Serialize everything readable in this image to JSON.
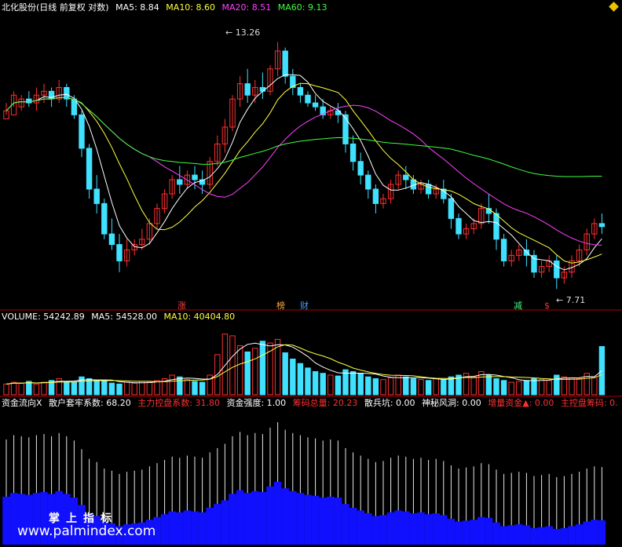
{
  "header": {
    "title": "北化股份(日线 前复权 对数)",
    "ma5": "MA5: 8.84",
    "ma10": "MA10: 8.60",
    "ma20": "MA20: 8.51",
    "ma60": "MA60: 9.13"
  },
  "volume_header": {
    "volume": "VOLUME: 54242.89",
    "ma5": "MA5: 54528.00",
    "ma10": "MA10: 40404.80"
  },
  "indicator_header": {
    "name": "资金流向X",
    "items": [
      {
        "label": "散户套牢系数: 68.20",
        "color": "#ffffff"
      },
      {
        "label": "主力控盘系数: 31.80",
        "color": "#ff3030"
      },
      {
        "label": "资金强度: 1.00",
        "color": "#ffffff"
      },
      {
        "label": "筹码总量: 20.23",
        "color": "#ff3030"
      },
      {
        "label": "散兵坑: 0.00",
        "color": "#ffffff"
      },
      {
        "label": "神秘风洞: 0.00",
        "color": "#ffffff"
      },
      {
        "label": "增量资金▲: 0.00",
        "color": "#ff3030"
      },
      {
        "label": "主控盘筹码: 0.",
        "color": "#ff3030"
      }
    ]
  },
  "annotations": {
    "high": "13.26",
    "low": "7.71"
  },
  "events": [
    {
      "label": "涨",
      "color": "#ff4040"
    },
    {
      "label": "榜",
      "color": "#ffaa40"
    },
    {
      "label": "财",
      "color": "#40a0ff"
    },
    {
      "label": "减",
      "color": "#40ff80"
    },
    {
      "label": "$",
      "color": "#ff3030"
    }
  ],
  "watermark": {
    "cn": "掌上指标",
    "url": "www.palmindex.com"
  },
  "colors": {
    "up": "#ff3030",
    "down": "#40e0ff",
    "ma5": "#ffffff",
    "ma10": "#ffff40",
    "ma20": "#ff40ff",
    "ma60": "#40ff40",
    "axis": "#b00000"
  },
  "chart_data": {
    "type": "candlestick",
    "scale": "log",
    "ylim": [
      7.4,
      14.0
    ],
    "candles": [
      [
        11.2,
        11.6,
        11.4,
        11.3
      ],
      [
        11.3,
        11.9,
        11.8,
        11.5
      ],
      [
        11.5,
        11.8,
        11.7,
        11.4
      ],
      [
        11.7,
        11.9,
        11.6,
        11.5
      ],
      [
        11.6,
        12.0,
        11.8,
        11.4
      ],
      [
        11.8,
        12.1,
        11.9,
        11.6
      ],
      [
        11.9,
        12.0,
        11.7,
        11.5
      ],
      [
        11.7,
        12.2,
        12.0,
        11.6
      ],
      [
        12.0,
        12.1,
        11.7,
        11.5
      ],
      [
        11.7,
        11.8,
        11.3,
        11.2
      ],
      [
        11.3,
        11.4,
        10.5,
        10.3
      ],
      [
        10.5,
        10.6,
        9.6,
        9.4
      ],
      [
        9.6,
        9.9,
        9.3,
        9.1
      ],
      [
        9.3,
        9.4,
        8.7,
        8.6
      ],
      [
        8.7,
        9.0,
        8.5,
        8.4
      ],
      [
        8.5,
        8.7,
        8.2,
        8.0
      ],
      [
        8.2,
        8.6,
        8.4,
        8.1
      ],
      [
        8.4,
        8.6,
        8.5,
        8.3
      ],
      [
        8.5,
        8.8,
        8.6,
        8.4
      ],
      [
        8.6,
        9.0,
        8.9,
        8.5
      ],
      [
        8.9,
        9.3,
        9.2,
        8.8
      ],
      [
        9.2,
        9.6,
        9.5,
        9.1
      ],
      [
        9.5,
        9.9,
        9.8,
        9.4
      ],
      [
        9.8,
        10.1,
        9.7,
        9.5
      ],
      [
        9.7,
        10.0,
        9.9,
        9.6
      ],
      [
        9.9,
        10.1,
        9.8,
        9.6
      ],
      [
        9.8,
        10.0,
        9.7,
        9.5
      ],
      [
        9.7,
        10.3,
        10.2,
        9.6
      ],
      [
        10.2,
        10.8,
        10.6,
        10.1
      ],
      [
        10.6,
        11.2,
        11.0,
        10.4
      ],
      [
        11.0,
        11.8,
        11.7,
        10.9
      ],
      [
        11.7,
        12.3,
        12.1,
        11.5
      ],
      [
        12.1,
        12.5,
        11.8,
        11.6
      ],
      [
        11.8,
        12.2,
        12.0,
        11.6
      ],
      [
        12.0,
        12.4,
        11.9,
        11.7
      ],
      [
        11.9,
        12.6,
        12.5,
        11.8
      ],
      [
        12.5,
        13.26,
        13.0,
        12.3
      ],
      [
        13.0,
        13.1,
        12.3,
        12.1
      ],
      [
        12.3,
        12.5,
        12.0,
        11.8
      ],
      [
        12.0,
        12.1,
        11.8,
        11.6
      ],
      [
        11.8,
        11.9,
        11.6,
        11.5
      ],
      [
        11.6,
        11.8,
        11.5,
        11.4
      ],
      [
        11.5,
        11.7,
        11.3,
        11.2
      ],
      [
        11.3,
        11.5,
        11.4,
        11.2
      ],
      [
        11.4,
        11.6,
        11.3,
        11.1
      ],
      [
        11.3,
        11.4,
        10.6,
        10.4
      ],
      [
        10.6,
        10.8,
        10.2,
        10.0
      ],
      [
        10.2,
        10.4,
        9.9,
        9.7
      ],
      [
        9.9,
        10.0,
        9.6,
        9.4
      ],
      [
        9.6,
        9.7,
        9.3,
        9.1
      ],
      [
        9.3,
        9.5,
        9.4,
        9.2
      ],
      [
        9.4,
        9.8,
        9.7,
        9.3
      ],
      [
        9.7,
        10.0,
        9.9,
        9.6
      ],
      [
        9.9,
        10.1,
        9.8,
        9.6
      ],
      [
        9.8,
        9.9,
        9.6,
        9.5
      ],
      [
        9.6,
        9.8,
        9.7,
        9.5
      ],
      [
        9.7,
        9.8,
        9.5,
        9.4
      ],
      [
        9.5,
        9.7,
        9.6,
        9.4
      ],
      [
        9.6,
        9.8,
        9.4,
        9.3
      ],
      [
        9.4,
        9.5,
        9.0,
        8.8
      ],
      [
        9.0,
        9.1,
        8.7,
        8.6
      ],
      [
        8.7,
        8.9,
        8.8,
        8.6
      ],
      [
        8.8,
        9.0,
        8.9,
        8.7
      ],
      [
        8.9,
        9.3,
        9.2,
        8.8
      ],
      [
        9.2,
        9.5,
        9.1,
        8.9
      ],
      [
        9.1,
        9.2,
        8.6,
        8.4
      ],
      [
        8.6,
        8.7,
        8.2,
        8.1
      ],
      [
        8.2,
        8.4,
        8.3,
        8.1
      ],
      [
        8.3,
        8.5,
        8.4,
        8.2
      ],
      [
        8.4,
        8.6,
        8.3,
        8.1
      ],
      [
        8.3,
        8.4,
        8.0,
        7.9
      ],
      [
        8.0,
        8.2,
        8.1,
        7.9
      ],
      [
        8.1,
        8.3,
        8.2,
        8.0
      ],
      [
        8.2,
        8.3,
        7.9,
        7.71
      ],
      [
        7.9,
        8.1,
        8.0,
        7.8
      ],
      [
        8.0,
        8.3,
        8.2,
        7.9
      ],
      [
        8.2,
        8.5,
        8.4,
        8.1
      ],
      [
        8.4,
        8.8,
        8.7,
        8.3
      ],
      [
        8.7,
        9.0,
        8.9,
        8.6
      ],
      [
        8.9,
        9.1,
        8.84,
        8.7
      ]
    ],
    "volume": [
      12,
      14,
      13,
      15,
      12,
      14,
      16,
      18,
      15,
      14,
      20,
      18,
      16,
      15,
      13,
      12,
      14,
      13,
      15,
      14,
      16,
      18,
      22,
      20,
      17,
      15,
      14,
      22,
      45,
      68,
      66,
      55,
      48,
      52,
      60,
      58,
      62,
      47,
      40,
      35,
      30,
      26,
      24,
      22,
      21,
      28,
      26,
      24,
      20,
      18,
      17,
      19,
      22,
      20,
      18,
      17,
      16,
      18,
      17,
      20,
      22,
      24,
      20,
      26,
      22,
      18,
      16,
      14,
      15,
      16,
      18,
      17,
      16,
      22,
      20,
      19,
      18,
      24,
      20,
      54
    ],
    "volume_ylim": [
      0,
      80
    ]
  }
}
